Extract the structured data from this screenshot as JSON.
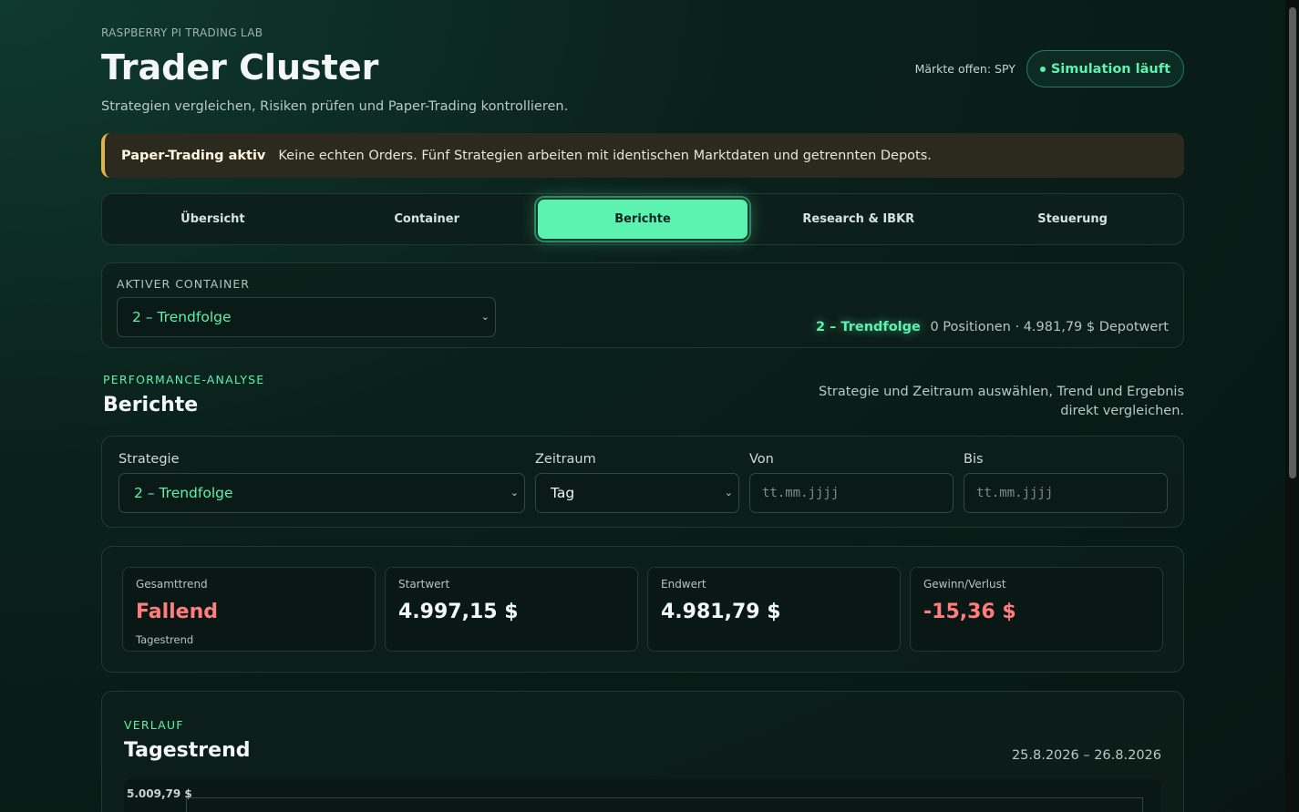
{
  "header": {
    "eyebrow": "RASPBERRY PI TRADING LAB",
    "title": "Trader Cluster",
    "subtitle": "Strategien vergleichen, Risiken prüfen und Paper-Trading kontrollieren.",
    "markets": "Märkte offen: SPY",
    "status_badge": "Simulation läuft"
  },
  "banner": {
    "title": "Paper-Trading aktiv",
    "text": "Keine echten Orders. Fünf Strategien arbeiten mit identischen Marktdaten und getrennten Depots."
  },
  "tabs": [
    "Übersicht",
    "Container",
    "Berichte",
    "Research & IBKR",
    "Steuerung"
  ],
  "active_tab": "Berichte",
  "container": {
    "label": "AKTIVER CONTAINER",
    "selected": "2 – Trendfolge",
    "summary_name": "2 – Trendfolge",
    "summary_text": "0 Positionen · 4.981,79 $ Depotwert"
  },
  "reports": {
    "eyebrow": "PERFORMANCE-ANALYSE",
    "title": "Berichte",
    "description": "Strategie und Zeitraum auswählen, Trend und Ergebnis direkt vergleichen.",
    "filters": {
      "strategy_label": "Strategie",
      "strategy_value": "2 – Trendfolge",
      "period_label": "Zeitraum",
      "period_value": "Tag",
      "from_label": "Von",
      "from_placeholder": "tt.mm.jjjj",
      "to_label": "Bis",
      "to_placeholder": "tt.mm.jjjj"
    },
    "stats": [
      {
        "label": "Gesamttrend",
        "value": "Fallend",
        "sub": "Tagestrend",
        "negative": true
      },
      {
        "label": "Startwert",
        "value": "4.997,15 $",
        "sub": "",
        "negative": false
      },
      {
        "label": "Endwert",
        "value": "4.981,79 $",
        "sub": "",
        "negative": false
      },
      {
        "label": "Gewinn/Verlust",
        "value": "-15,36 $",
        "sub": "",
        "negative": true
      }
    ]
  },
  "history": {
    "eyebrow": "VERLAUF",
    "title": "Tagestrend",
    "range": "25.8.2026 – 26.8.2026",
    "y_top_label": "5.009,79 $"
  },
  "colors": {
    "accent": "#5cf2b0",
    "negative": "#ff7d7d",
    "warning": "#e3b24a"
  }
}
